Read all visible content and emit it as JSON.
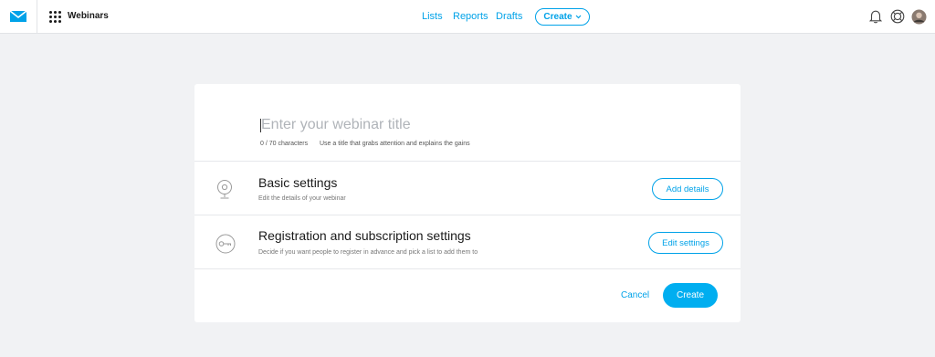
{
  "header": {
    "product_name": "Webinars",
    "nav": [
      "Lists",
      "Reports",
      "Drafts"
    ],
    "create_label": "Create",
    "icons": [
      "envelope-logo-icon",
      "apps-grid-icon",
      "bell-icon",
      "lifebuoy-icon",
      "avatar"
    ]
  },
  "title_section": {
    "placeholder": "Enter your webinar title",
    "value": "",
    "char_count": "0 / 70 characters",
    "hint": "Use a title that grabs attention and explains the gains"
  },
  "sections": [
    {
      "title": "Basic settings",
      "description": "Edit the details of your webinar",
      "button": "Add details",
      "icon": "webcam-icon"
    },
    {
      "title": "Registration and subscription settings",
      "description": "Decide if you want people to register in advance and pick a list to add them to",
      "button": "Edit settings",
      "icon": "key-icon"
    }
  ],
  "footer": {
    "cancel_label": "Cancel",
    "create_label": "Create"
  },
  "colors": {
    "accent": "#00a2e8",
    "primary_button": "#00aef0",
    "background": "#f1f2f4"
  }
}
